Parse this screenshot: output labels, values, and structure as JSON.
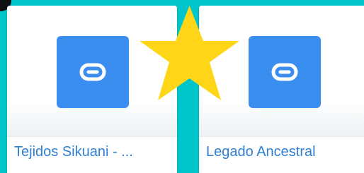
{
  "cards": [
    {
      "title": "Tejidos Sikuani - ...",
      "tile_color": "#3a8ef0",
      "icon": "link-icon"
    },
    {
      "title": "Legado Ancestral",
      "tile_color": "#3a8ef0",
      "icon": "link-icon"
    }
  ],
  "overlay": {
    "icon": "star-icon",
    "color": "#ffd617"
  },
  "colors": {
    "background": "#00c6cc",
    "title_text": "#2f80d2",
    "card_background": "#ffffff"
  }
}
